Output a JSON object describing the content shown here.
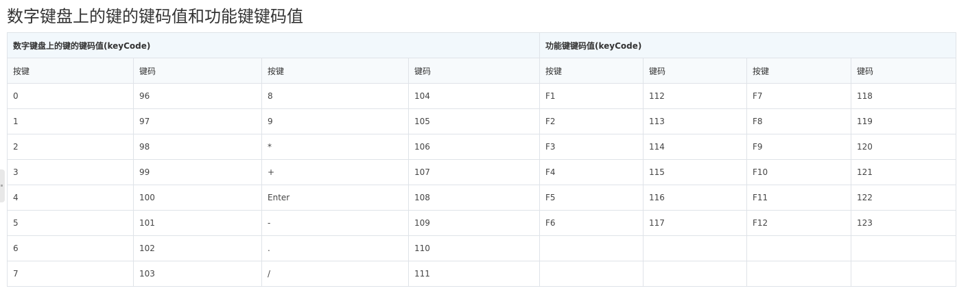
{
  "page": {
    "title": "数字键盘上的键的键码值和功能键键码值"
  },
  "table": {
    "groups": [
      "数字键盘上的键的键码值(keyCode)",
      "功能键键码值(keyCode)"
    ],
    "headers": [
      "按键",
      "键码",
      "按键",
      "键码",
      "按键",
      "键码",
      "按键",
      "键码"
    ],
    "rows": [
      [
        "0",
        "96",
        "8",
        "104",
        "F1",
        "112",
        "F7",
        "118"
      ],
      [
        "1",
        "97",
        "9",
        "105",
        "F2",
        "113",
        "F8",
        "119"
      ],
      [
        "2",
        "98",
        "*",
        "106",
        "F3",
        "114",
        "F9",
        "120"
      ],
      [
        "3",
        "99",
        "+",
        "107",
        "F4",
        "115",
        "F10",
        "121"
      ],
      [
        "4",
        "100",
        "Enter",
        "108",
        "F5",
        "116",
        "F11",
        "122"
      ],
      [
        "5",
        "101",
        "-",
        "109",
        "F6",
        "117",
        "F12",
        "123"
      ],
      [
        "6",
        "102",
        ".",
        "110",
        "",
        "",
        "",
        ""
      ],
      [
        "7",
        "103",
        "/",
        "111",
        "",
        "",
        "",
        ""
      ]
    ]
  },
  "colors": {
    "border": "#dfe3e8",
    "group_header_bg": "#f2f8fc",
    "column_header_bg": "#f7fafc",
    "text": "#333333"
  }
}
